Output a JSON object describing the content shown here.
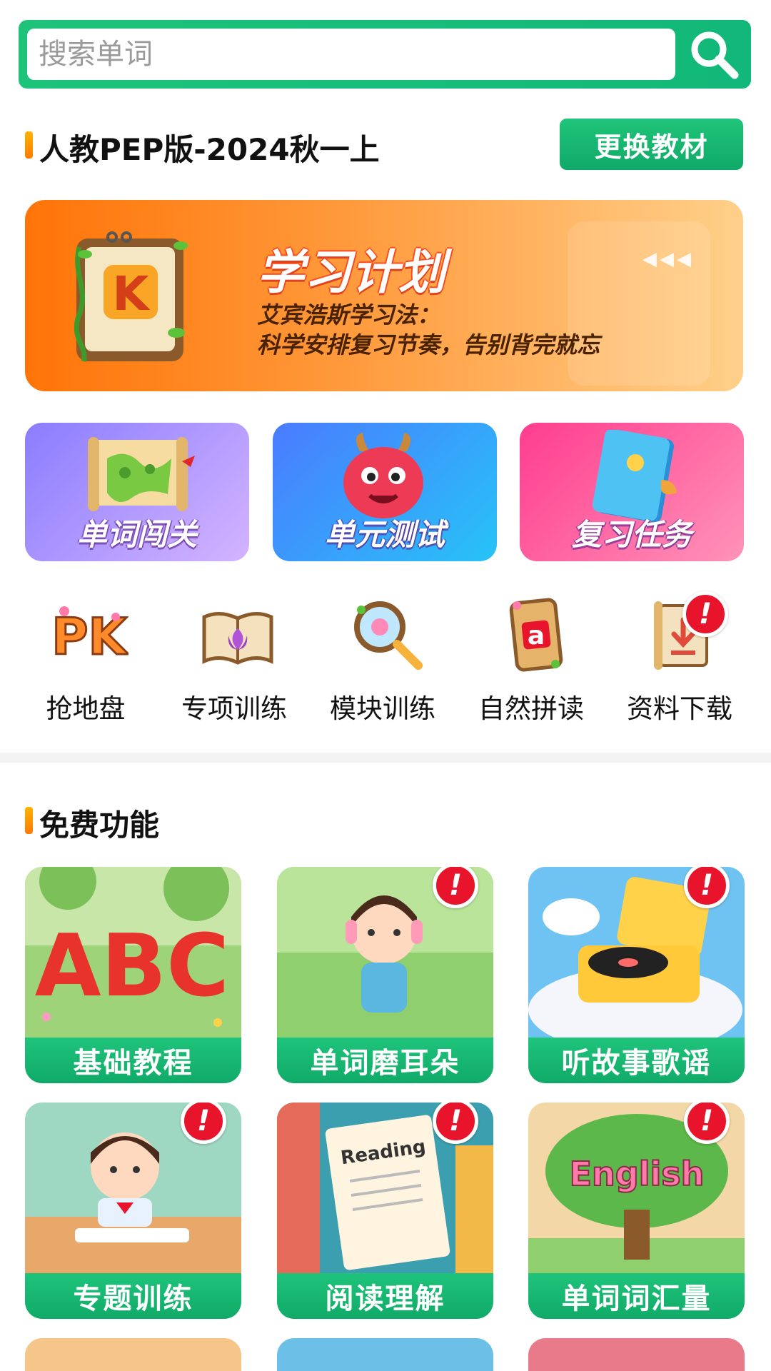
{
  "search": {
    "placeholder": "搜索单词"
  },
  "textbook": {
    "title": "人教PEP版-2024秋一上",
    "change_button": "更换教材"
  },
  "plan_banner": {
    "title": "学习计划",
    "subtitle_line1": "艾宾浩斯学习法：",
    "subtitle_line2": "科学安排复习节奏，告别背完就忘",
    "book_letter": "K"
  },
  "feature_cards": [
    {
      "label": "单词闯关",
      "icon": "map-scroll-icon"
    },
    {
      "label": "单元测试",
      "icon": "monster-icon"
    },
    {
      "label": "复习任务",
      "icon": "book-icon"
    }
  ],
  "quick_icons": [
    {
      "label": "抢地盘",
      "icon": "pk-icon",
      "badge": false
    },
    {
      "label": "专项训练",
      "icon": "open-book-icon",
      "badge": false
    },
    {
      "label": "模块训练",
      "icon": "magnifier-icon",
      "badge": false
    },
    {
      "label": "自然拼读",
      "icon": "letter-card-icon",
      "badge": false
    },
    {
      "label": "资料下载",
      "icon": "download-scroll-icon",
      "badge": true
    }
  ],
  "free_section": {
    "title": "免费功能"
  },
  "free_cards": [
    {
      "label": "基础教程",
      "art": "abc-letters-art",
      "badge": false
    },
    {
      "label": "单词磨耳朵",
      "art": "girl-headphones-art",
      "badge": true
    },
    {
      "label": "听故事歌谣",
      "art": "record-player-art",
      "badge": true
    },
    {
      "label": "专题训练",
      "art": "girl-writing-art",
      "badge": true
    },
    {
      "label": "阅读理解",
      "art": "reading-paper-art",
      "badge": true,
      "art_text": "Reading"
    },
    {
      "label": "单词词汇量",
      "art": "english-tree-art",
      "badge": true,
      "art_text": "English"
    }
  ],
  "pk_letters": "PK",
  "phonics_letter": "a",
  "abc_letters": "ABC",
  "badge_mark": "!",
  "colors": {
    "brand_green": "#1ec37a",
    "badge_red": "#e8142c",
    "accent_orange": "#ff8a00"
  }
}
